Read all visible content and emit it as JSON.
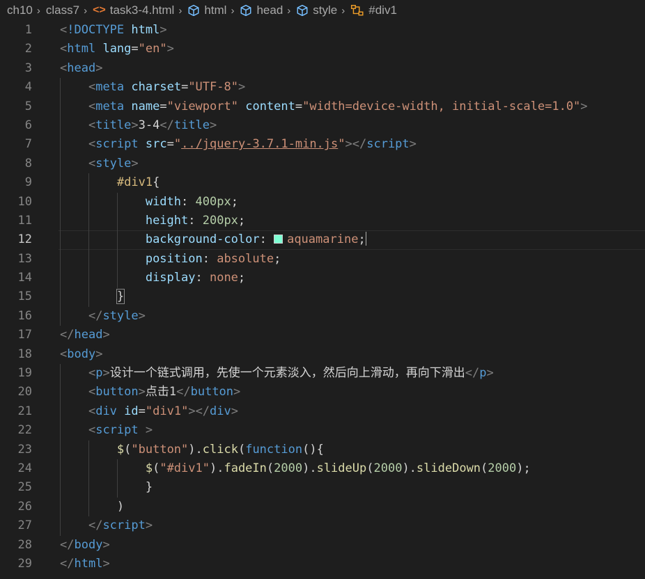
{
  "breadcrumb": {
    "items": [
      "ch10",
      "class7",
      "task3-4.html",
      "html",
      "head",
      "style",
      "#div1"
    ],
    "icons": [
      "",
      "",
      "file-code-icon",
      "cube-icon",
      "cube-icon",
      "cube-icon",
      "symbol-class-icon"
    ]
  },
  "editor": {
    "active_line": 12,
    "line_numbers": [
      "1",
      "2",
      "3",
      "4",
      "5",
      "6",
      "7",
      "8",
      "9",
      "10",
      "11",
      "12",
      "13",
      "14",
      "15",
      "16",
      "17",
      "18",
      "19",
      "20",
      "21",
      "22",
      "23",
      "24",
      "25",
      "26",
      "27",
      "28",
      "29"
    ],
    "lines": [
      [
        [
          "p",
          "<"
        ],
        [
          "t",
          "!DOCTYPE"
        ],
        [
          "w",
          " "
        ],
        [
          "a",
          "html"
        ],
        [
          "p",
          ">"
        ]
      ],
      [
        [
          "p",
          "<"
        ],
        [
          "t",
          "html"
        ],
        [
          "w",
          " "
        ],
        [
          "a",
          "lang"
        ],
        [
          "w",
          "="
        ],
        [
          "s",
          "\"en\""
        ],
        [
          "p",
          ">"
        ]
      ],
      [
        [
          "p",
          "<"
        ],
        [
          "t",
          "head"
        ],
        [
          "p",
          ">"
        ]
      ],
      [
        [
          "w",
          "    "
        ],
        [
          "p",
          "<"
        ],
        [
          "t",
          "meta"
        ],
        [
          "w",
          " "
        ],
        [
          "a",
          "charset"
        ],
        [
          "w",
          "="
        ],
        [
          "s",
          "\"UTF-8\""
        ],
        [
          "p",
          ">"
        ]
      ],
      [
        [
          "w",
          "    "
        ],
        [
          "p",
          "<"
        ],
        [
          "t",
          "meta"
        ],
        [
          "w",
          " "
        ],
        [
          "a",
          "name"
        ],
        [
          "w",
          "="
        ],
        [
          "s",
          "\"viewport\""
        ],
        [
          "w",
          " "
        ],
        [
          "a",
          "content"
        ],
        [
          "w",
          "="
        ],
        [
          "s",
          "\"width=device-width, initial-scale=1.0\""
        ],
        [
          "p",
          ">"
        ]
      ],
      [
        [
          "w",
          "    "
        ],
        [
          "p",
          "<"
        ],
        [
          "t",
          "title"
        ],
        [
          "p",
          ">"
        ],
        [
          "w",
          "3-4"
        ],
        [
          "p",
          "</"
        ],
        [
          "t",
          "title"
        ],
        [
          "p",
          ">"
        ]
      ],
      [
        [
          "w",
          "    "
        ],
        [
          "p",
          "<"
        ],
        [
          "t",
          "script"
        ],
        [
          "w",
          " "
        ],
        [
          "a",
          "src"
        ],
        [
          "w",
          "="
        ],
        [
          "s",
          "\""
        ],
        [
          "su",
          "../jquery-3.7.1-min.js"
        ],
        [
          "s",
          "\""
        ],
        [
          "p",
          "></"
        ],
        [
          "t",
          "script"
        ],
        [
          "p",
          ">"
        ]
      ],
      [
        [
          "w",
          "    "
        ],
        [
          "p",
          "<"
        ],
        [
          "t",
          "style"
        ],
        [
          "p",
          ">"
        ]
      ],
      [
        [
          "w",
          "        "
        ],
        [
          "sel",
          "#div1"
        ],
        [
          "w",
          "{"
        ]
      ],
      [
        [
          "w",
          "            "
        ],
        [
          "prop",
          "width"
        ],
        [
          "w",
          ": "
        ],
        [
          "num",
          "400px"
        ],
        [
          "w",
          ";"
        ]
      ],
      [
        [
          "w",
          "            "
        ],
        [
          "prop",
          "height"
        ],
        [
          "w",
          ": "
        ],
        [
          "num",
          "200px"
        ],
        [
          "w",
          ";"
        ]
      ],
      [
        [
          "w",
          "            "
        ],
        [
          "prop",
          "background-color"
        ],
        [
          "w",
          ": "
        ],
        [
          "swatch",
          "#7fffd4"
        ],
        [
          "val",
          "aquamarine"
        ],
        [
          "w",
          ";"
        ],
        [
          "cursor",
          ""
        ]
      ],
      [
        [
          "w",
          "            "
        ],
        [
          "prop",
          "position"
        ],
        [
          "w",
          ": "
        ],
        [
          "val",
          "absolute"
        ],
        [
          "w",
          ";"
        ]
      ],
      [
        [
          "w",
          "            "
        ],
        [
          "prop",
          "display"
        ],
        [
          "w",
          ": "
        ],
        [
          "val",
          "none"
        ],
        [
          "w",
          ";"
        ]
      ],
      [
        [
          "w",
          "        "
        ],
        [
          "brk",
          "}"
        ]
      ],
      [
        [
          "w",
          "    "
        ],
        [
          "p",
          "</"
        ],
        [
          "t",
          "style"
        ],
        [
          "p",
          ">"
        ]
      ],
      [
        [
          "p",
          "</"
        ],
        [
          "t",
          "head"
        ],
        [
          "p",
          ">"
        ]
      ],
      [
        [
          "p",
          "<"
        ],
        [
          "t",
          "body"
        ],
        [
          "p",
          ">"
        ]
      ],
      [
        [
          "w",
          "    "
        ],
        [
          "p",
          "<"
        ],
        [
          "t",
          "p"
        ],
        [
          "p",
          ">"
        ],
        [
          "w",
          "设计一个链式调用，先使一个元素淡入，然后向上滑动，再向下滑出"
        ],
        [
          "p",
          "</"
        ],
        [
          "t",
          "p"
        ],
        [
          "p",
          ">"
        ]
      ],
      [
        [
          "w",
          "    "
        ],
        [
          "p",
          "<"
        ],
        [
          "t",
          "button"
        ],
        [
          "p",
          ">"
        ],
        [
          "w",
          "点击1"
        ],
        [
          "p",
          "</"
        ],
        [
          "t",
          "button"
        ],
        [
          "p",
          ">"
        ]
      ],
      [
        [
          "w",
          "    "
        ],
        [
          "p",
          "<"
        ],
        [
          "t",
          "div"
        ],
        [
          "w",
          " "
        ],
        [
          "a",
          "id"
        ],
        [
          "w",
          "="
        ],
        [
          "s",
          "\"div1\""
        ],
        [
          "p",
          "></"
        ],
        [
          "t",
          "div"
        ],
        [
          "p",
          ">"
        ]
      ],
      [
        [
          "w",
          "    "
        ],
        [
          "p",
          "<"
        ],
        [
          "t",
          "script"
        ],
        [
          "w",
          " "
        ],
        [
          "p",
          ">"
        ]
      ],
      [
        [
          "w",
          "        "
        ],
        [
          "fn",
          "$"
        ],
        [
          "w",
          "("
        ],
        [
          "s",
          "\"button\""
        ],
        [
          "w",
          ")."
        ],
        [
          "fn",
          "click"
        ],
        [
          "w",
          "("
        ],
        [
          "kw",
          "function"
        ],
        [
          "w",
          "(){"
        ]
      ],
      [
        [
          "w",
          "            "
        ],
        [
          "fn",
          "$"
        ],
        [
          "w",
          "("
        ],
        [
          "s",
          "\"#div1\""
        ],
        [
          "w",
          ")."
        ],
        [
          "fn",
          "fadeIn"
        ],
        [
          "w",
          "("
        ],
        [
          "num",
          "2000"
        ],
        [
          "w",
          ")."
        ],
        [
          "fn",
          "slideUp"
        ],
        [
          "w",
          "("
        ],
        [
          "num",
          "2000"
        ],
        [
          "w",
          ")."
        ],
        [
          "fn",
          "slideDown"
        ],
        [
          "w",
          "("
        ],
        [
          "num",
          "2000"
        ],
        [
          "w",
          ");"
        ]
      ],
      [
        [
          "w",
          "            }"
        ]
      ],
      [
        [
          "w",
          "        )"
        ]
      ],
      [
        [
          "w",
          "    "
        ],
        [
          "p",
          "</"
        ],
        [
          "t",
          "script"
        ],
        [
          "p",
          ">"
        ]
      ],
      [
        [
          "p",
          "</"
        ],
        [
          "t",
          "body"
        ],
        [
          "p",
          ">"
        ]
      ],
      [
        [
          "p",
          "</"
        ],
        [
          "t",
          "html"
        ],
        [
          "p",
          ">"
        ]
      ]
    ]
  },
  "colors": {
    "background": "#1e1e1e",
    "tag": "#569cd6",
    "attribute": "#9cdcfe",
    "string": "#ce9178",
    "number": "#b5cea8",
    "function": "#dcdcaa",
    "selector": "#d7ba7d",
    "swatch": "#7fffd4"
  }
}
